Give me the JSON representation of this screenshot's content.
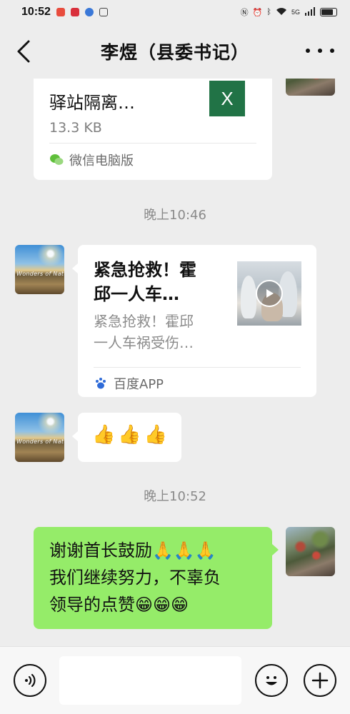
{
  "status_bar": {
    "time": "10:52",
    "right_text": "5G",
    "battery_level": 0.8
  },
  "header": {
    "title": "李煜（县委书记）"
  },
  "messages": {
    "file_card": {
      "name_line1": "驿站隔离…",
      "size": "13.3 KB",
      "icon_letter": "X",
      "source": "微信电脑版",
      "icon_color": "#217346"
    },
    "time1": "晚上10:46",
    "link_card": {
      "title_line1": "紧急抢救！霍",
      "title_line2": "邱一人车…",
      "desc_line1": "紧急抢救！霍邱",
      "desc_line2": "一人车祸受伤…",
      "source": "百度APP"
    },
    "thumbs": [
      "👍",
      "👍",
      "👍"
    ],
    "time2": "晚上10:52",
    "reply": {
      "line1": "谢谢首长鼓励🙏🙏🙏",
      "line2": "我们继续努力，不辜负",
      "line3": "领导的点赞😁😁😁"
    },
    "avatar_watermark": "Wonders of Nature"
  },
  "colors": {
    "background": "#ededed",
    "sent_bubble": "#95ec69",
    "received_bubble": "#ffffff"
  }
}
